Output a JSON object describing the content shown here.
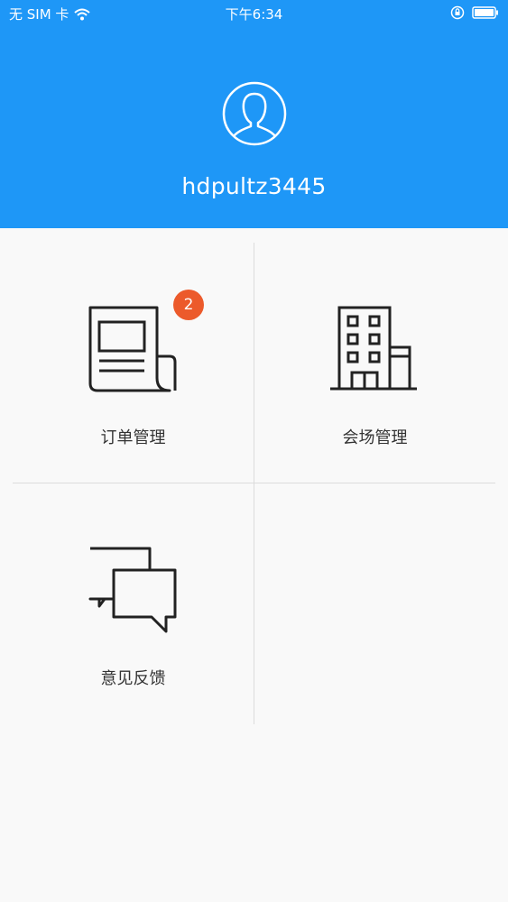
{
  "status_bar": {
    "carrier": "无 SIM 卡",
    "time": "下午6:34",
    "icons": [
      "wifi-icon",
      "orientation-lock-icon",
      "battery-icon"
    ]
  },
  "profile": {
    "username": "hdpultz3445",
    "avatar_icon": "user-avatar-icon"
  },
  "menu": {
    "orders": {
      "label": "订单管理",
      "badge": "2",
      "icon": "newspaper-icon"
    },
    "venues": {
      "label": "会场管理",
      "icon": "building-icon"
    },
    "feedback": {
      "label": "意见反馈",
      "icon": "chat-bubbles-icon"
    }
  },
  "colors": {
    "header": "#1e97f7",
    "badge": "#ec5a2b",
    "background": "#f9f9f9"
  }
}
